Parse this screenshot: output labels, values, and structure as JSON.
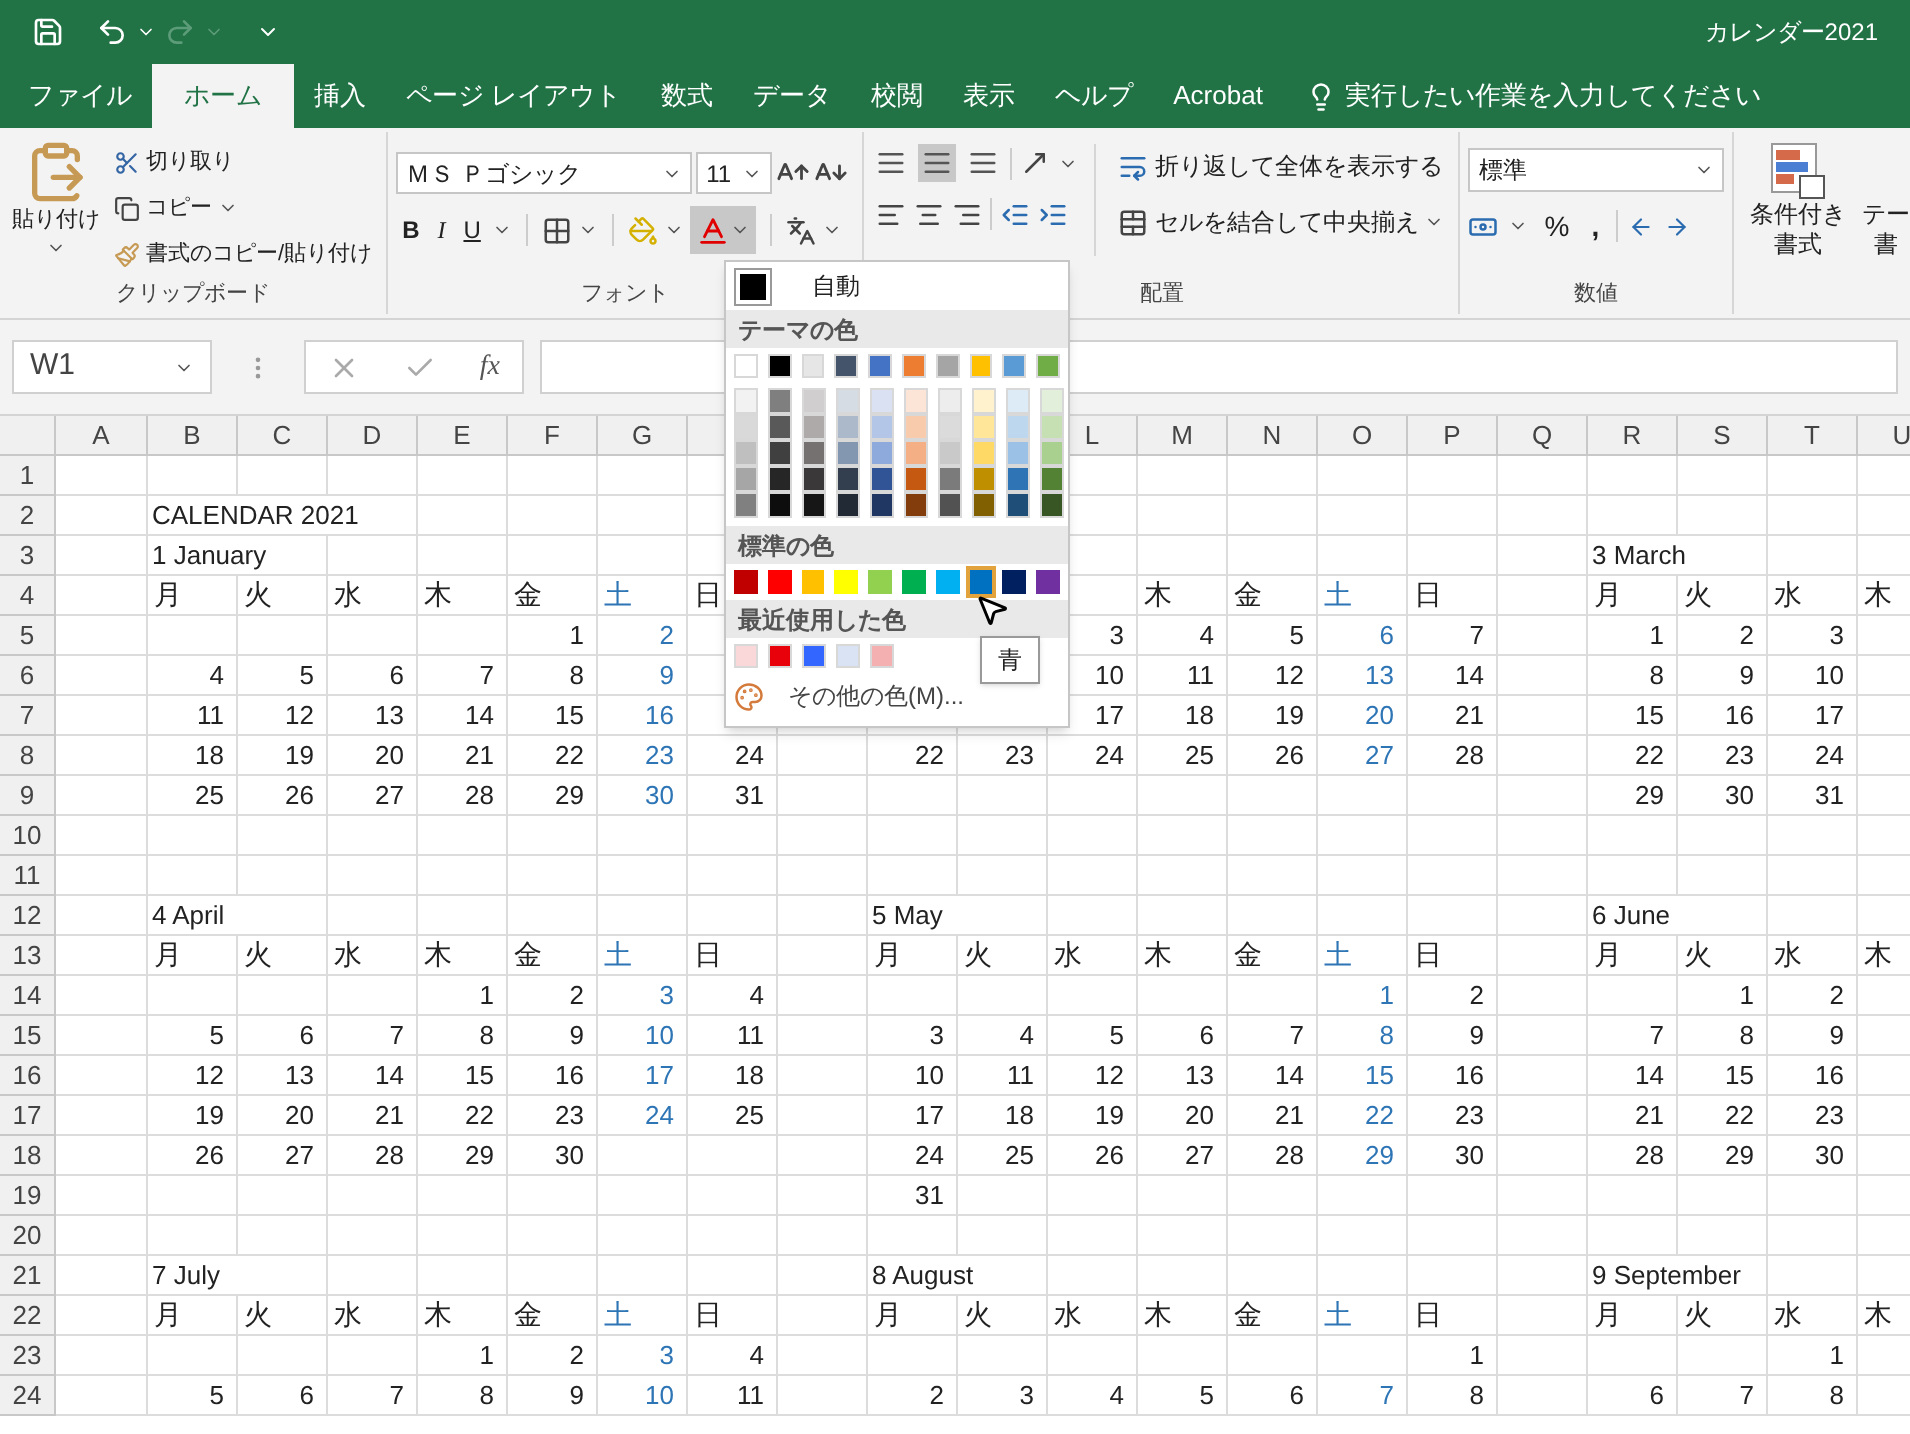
{
  "title_bar": {
    "document_title": "カレンダー2021",
    "redo_disabled": true
  },
  "tabs": [
    {
      "label": "ファイル",
      "selected": false
    },
    {
      "label": "ホーム",
      "selected": true
    },
    {
      "label": "挿入",
      "selected": false
    },
    {
      "label": "ページ レイアウト",
      "selected": false
    },
    {
      "label": "数式",
      "selected": false
    },
    {
      "label": "データ",
      "selected": false
    },
    {
      "label": "校閲",
      "selected": false
    },
    {
      "label": "表示",
      "selected": false
    },
    {
      "label": "ヘルプ",
      "selected": false
    },
    {
      "label": "Acrobat",
      "selected": false
    }
  ],
  "tell_me": {
    "placeholder": "実行したい作業を入力してください"
  },
  "ribbon": {
    "clipboard": {
      "paste": "貼り付け",
      "cut": "切り取り",
      "copy": "コピー",
      "format_painter": "書式のコピー/貼り付け",
      "label": "クリップボード"
    },
    "font": {
      "font_name": "ＭＳ Ｐゴシック",
      "font_size": "11",
      "bold": "B",
      "italic": "I",
      "underline": "U",
      "font_color_open": true,
      "label": "フォント"
    },
    "alignment": {
      "vertical": [
        {
          "selected": false
        },
        {
          "selected": true
        },
        {
          "selected": false
        }
      ],
      "wrap_text": "折り返して全体を表示する",
      "merge_center": "セルを結合して中央揃え",
      "label": "配置"
    },
    "number": {
      "format": "標準",
      "percent": "%",
      "comma": ",",
      "label": "数値"
    },
    "styles": {
      "conditional_formatting": [
        "条件付き",
        "書式"
      ],
      "table_format": [
        "テー",
        "書"
      ]
    }
  },
  "formula_bar": {
    "name_box": "W1",
    "function_label": "fx"
  },
  "sheet": {
    "columns": [
      "A",
      "B",
      "C",
      "D",
      "E",
      "F",
      "G",
      null,
      null,
      null,
      null,
      "L",
      "M",
      "N",
      "O",
      "P",
      "Q",
      "R",
      "S",
      "T",
      "U"
    ],
    "rows": [
      {
        "number": "1",
        "kind": "blank"
      },
      {
        "number": "2",
        "kind": "title",
        "cells": [
          null,
          "CALENDAR 2021"
        ]
      },
      {
        "number": "3",
        "kind": "month",
        "cells": [
          null,
          "1 January",
          null,
          null,
          null,
          null,
          null,
          null,
          null,
          null,
          null,
          null,
          null,
          null,
          null,
          null,
          null,
          "3 March"
        ]
      },
      {
        "number": "4",
        "kind": "weekdays",
        "cells": [
          null,
          "月",
          "火",
          "水",
          "木",
          "金",
          {
            "text": "土",
            "color": "#2e75b6"
          },
          "日",
          null,
          null,
          null,
          null,
          "木",
          "金",
          {
            "text": "土",
            "color": "#2e75b6"
          },
          "日",
          null,
          "月",
          "火",
          "水",
          "木"
        ]
      },
      {
        "number": "5",
        "kind": "dates",
        "cells": [
          null,
          null,
          null,
          null,
          null,
          "1",
          {
            "text": "2",
            "color": "#2e75b6"
          },
          null,
          null,
          null,
          null,
          "3",
          "4",
          "5",
          {
            "text": "6",
            "color": "#2e75b6"
          },
          "7",
          null,
          "1",
          "2",
          "3"
        ]
      },
      {
        "number": "6",
        "kind": "dates",
        "cells": [
          null,
          "4",
          "5",
          "6",
          "7",
          "8",
          {
            "text": "9",
            "color": "#2e75b6"
          },
          null,
          null,
          null,
          null,
          "10",
          "11",
          "12",
          {
            "text": "13",
            "color": "#2e75b6"
          },
          "14",
          null,
          "8",
          "9",
          "10"
        ]
      },
      {
        "number": "7",
        "kind": "dates",
        "cells": [
          null,
          "11",
          "12",
          "13",
          "14",
          "15",
          {
            "text": "16",
            "color": "#2e75b6"
          },
          null,
          null,
          null,
          null,
          "17",
          "18",
          "19",
          {
            "text": "20",
            "color": "#2e75b6"
          },
          "21",
          null,
          "15",
          "16",
          "17"
        ]
      },
      {
        "number": "8",
        "kind": "dates",
        "cells": [
          null,
          "18",
          "19",
          "20",
          "21",
          "22",
          {
            "text": "23",
            "color": "#2e75b6"
          },
          "24",
          null,
          "22",
          "23",
          "24",
          "25",
          "26",
          {
            "text": "27",
            "color": "#2e75b6"
          },
          "28",
          null,
          "22",
          "23",
          "24"
        ]
      },
      {
        "number": "9",
        "kind": "dates",
        "cells": [
          null,
          "25",
          "26",
          "27",
          "28",
          "29",
          {
            "text": "30",
            "color": "#2e75b6"
          },
          "31",
          null,
          null,
          null,
          null,
          null,
          null,
          null,
          null,
          null,
          "29",
          "30",
          "31"
        ]
      },
      {
        "number": "10",
        "kind": "blank"
      },
      {
        "number": "11",
        "kind": "blank"
      },
      {
        "number": "12",
        "kind": "month",
        "cells": [
          null,
          "4 April",
          null,
          null,
          null,
          null,
          null,
          null,
          null,
          "5 May",
          null,
          null,
          null,
          null,
          null,
          null,
          null,
          "6 June"
        ]
      },
      {
        "number": "13",
        "kind": "weekdays",
        "cells": [
          null,
          "月",
          "火",
          "水",
          "木",
          "金",
          {
            "text": "土",
            "color": "#2e75b6"
          },
          "日",
          null,
          "月",
          "火",
          "水",
          "木",
          "金",
          {
            "text": "土",
            "color": "#2e75b6"
          },
          "日",
          null,
          "月",
          "火",
          "水",
          "木"
        ]
      },
      {
        "number": "14",
        "kind": "dates",
        "cells": [
          null,
          null,
          null,
          null,
          "1",
          "2",
          {
            "text": "3",
            "color": "#2e75b6"
          },
          "4",
          null,
          null,
          null,
          null,
          null,
          null,
          {
            "text": "1",
            "color": "#2e75b6"
          },
          "2",
          null,
          null,
          "1",
          "2"
        ]
      },
      {
        "number": "15",
        "kind": "dates",
        "cells": [
          null,
          "5",
          "6",
          "7",
          "8",
          "9",
          {
            "text": "10",
            "color": "#2e75b6"
          },
          "11",
          null,
          "3",
          "4",
          "5",
          "6",
          "7",
          {
            "text": "8",
            "color": "#2e75b6"
          },
          "9",
          null,
          "7",
          "8",
          "9"
        ]
      },
      {
        "number": "16",
        "kind": "dates",
        "cells": [
          null,
          "12",
          "13",
          "14",
          "15",
          "16",
          {
            "text": "17",
            "color": "#2e75b6"
          },
          "18",
          null,
          "10",
          "11",
          "12",
          "13",
          "14",
          {
            "text": "15",
            "color": "#2e75b6"
          },
          "16",
          null,
          "14",
          "15",
          "16"
        ]
      },
      {
        "number": "17",
        "kind": "dates",
        "cells": [
          null,
          "19",
          "20",
          "21",
          "22",
          "23",
          {
            "text": "24",
            "color": "#2e75b6"
          },
          "25",
          null,
          "17",
          "18",
          "19",
          "20",
          "21",
          {
            "text": "22",
            "color": "#2e75b6"
          },
          "23",
          null,
          "21",
          "22",
          "23"
        ]
      },
      {
        "number": "18",
        "kind": "dates",
        "cells": [
          null,
          "26",
          "27",
          "28",
          "29",
          "30",
          null,
          null,
          null,
          "24",
          "25",
          "26",
          "27",
          "28",
          {
            "text": "29",
            "color": "#2e75b6"
          },
          "30",
          null,
          "28",
          "29",
          "30"
        ]
      },
      {
        "number": "19",
        "kind": "dates",
        "cells": [
          null,
          null,
          null,
          null,
          null,
          null,
          null,
          null,
          null,
          "31"
        ]
      },
      {
        "number": "20",
        "kind": "blank"
      },
      {
        "number": "21",
        "kind": "month",
        "cells": [
          null,
          "7 July",
          null,
          null,
          null,
          null,
          null,
          null,
          null,
          "8 August",
          null,
          null,
          null,
          null,
          null,
          null,
          null,
          "9 September"
        ]
      },
      {
        "number": "22",
        "kind": "weekdays",
        "cells": [
          null,
          "月",
          "火",
          "水",
          "木",
          "金",
          {
            "text": "土",
            "color": "#2e75b6"
          },
          "日",
          null,
          "月",
          "火",
          "水",
          "木",
          "金",
          {
            "text": "土",
            "color": "#2e75b6"
          },
          "日",
          null,
          "月",
          "火",
          "水",
          "木"
        ]
      },
      {
        "number": "23",
        "kind": "dates",
        "cells": [
          null,
          null,
          null,
          null,
          "1",
          "2",
          {
            "text": "3",
            "color": "#2e75b6"
          },
          "4",
          null,
          null,
          null,
          null,
          null,
          null,
          null,
          "1",
          null,
          null,
          null,
          "1"
        ]
      },
      {
        "number": "24",
        "kind": "dates",
        "cells": [
          null,
          "5",
          "6",
          "7",
          "8",
          "9",
          {
            "text": "10",
            "color": "#2e75b6"
          },
          "11",
          null,
          "2",
          "3",
          "4",
          "5",
          "6",
          {
            "text": "7",
            "color": "#2e75b6"
          },
          "8",
          null,
          "6",
          "7",
          "8"
        ]
      }
    ]
  },
  "font_color_menu": {
    "automatic": {
      "label": "自動",
      "color": "#000000"
    },
    "theme_title": "テーマの色",
    "theme_colors": [
      {
        "color": "#ffffff",
        "shades": [
          {
            "color": "#f2f2f2"
          },
          {
            "color": "#d9d9d9"
          },
          {
            "color": "#bfbfbf"
          },
          {
            "color": "#a6a6a6"
          },
          {
            "color": "#808080"
          }
        ]
      },
      {
        "color": "#000000",
        "shades": [
          {
            "color": "#7f7f7f"
          },
          {
            "color": "#595959"
          },
          {
            "color": "#404040"
          },
          {
            "color": "#262626"
          },
          {
            "color": "#0d0d0d"
          }
        ]
      },
      {
        "color": "#e7e6e6",
        "shades": [
          {
            "color": "#d0cece"
          },
          {
            "color": "#aeaaaa"
          },
          {
            "color": "#757171"
          },
          {
            "color": "#3a3838"
          },
          {
            "color": "#161616"
          }
        ]
      },
      {
        "color": "#44546a",
        "shades": [
          {
            "color": "#d6dce4"
          },
          {
            "color": "#acb9ca"
          },
          {
            "color": "#8497b0"
          },
          {
            "color": "#333f4f"
          },
          {
            "color": "#222b35"
          }
        ]
      },
      {
        "color": "#4472c4",
        "shades": [
          {
            "color": "#d9e1f2"
          },
          {
            "color": "#b4c6e7"
          },
          {
            "color": "#8ea9db"
          },
          {
            "color": "#305496"
          },
          {
            "color": "#203764"
          }
        ]
      },
      {
        "color": "#ed7d31",
        "shades": [
          {
            "color": "#fce4d6"
          },
          {
            "color": "#f8cbad"
          },
          {
            "color": "#f4b084"
          },
          {
            "color": "#c65911"
          },
          {
            "color": "#833c0c"
          }
        ]
      },
      {
        "color": "#a5a5a5",
        "shades": [
          {
            "color": "#ededed"
          },
          {
            "color": "#dbdbdb"
          },
          {
            "color": "#c9c9c9"
          },
          {
            "color": "#7b7b7b"
          },
          {
            "color": "#525252"
          }
        ]
      },
      {
        "color": "#ffc000",
        "shades": [
          {
            "color": "#fff2cc"
          },
          {
            "color": "#ffe699"
          },
          {
            "color": "#ffd966"
          },
          {
            "color": "#bf8f00"
          },
          {
            "color": "#806000"
          }
        ]
      },
      {
        "color": "#5b9bd5",
        "shades": [
          {
            "color": "#ddebf7"
          },
          {
            "color": "#bdd7ee"
          },
          {
            "color": "#9bc2e6"
          },
          {
            "color": "#2f75b5"
          },
          {
            "color": "#1f4e78"
          }
        ]
      },
      {
        "color": "#70ad47",
        "shades": [
          {
            "color": "#e2efda"
          },
          {
            "color": "#c6e0b4"
          },
          {
            "color": "#a9d08e"
          },
          {
            "color": "#548235"
          },
          {
            "color": "#375623"
          }
        ]
      }
    ],
    "standard_title": "標準の色",
    "standard_colors": [
      {
        "color": "#c00000",
        "selected": false
      },
      {
        "color": "#ff0000",
        "selected": false
      },
      {
        "color": "#ffc000",
        "selected": false
      },
      {
        "color": "#ffff00",
        "selected": false
      },
      {
        "color": "#92d050",
        "selected": false
      },
      {
        "color": "#00b050",
        "selected": false
      },
      {
        "color": "#00b0f0",
        "selected": false
      },
      {
        "color": "#0070c0",
        "selected": true
      },
      {
        "color": "#002060",
        "selected": false
      },
      {
        "color": "#7030a0",
        "selected": false
      }
    ],
    "recent_title": "最近使用した色",
    "recent_colors": [
      {
        "color": "#fad7d9"
      },
      {
        "color": "#e8000b"
      },
      {
        "color": "#3366ff"
      },
      {
        "color": "#dae3f3"
      },
      {
        "color": "#f4b0b0"
      }
    ],
    "more_colors": "その他の色(M)...",
    "tooltip": "青"
  }
}
